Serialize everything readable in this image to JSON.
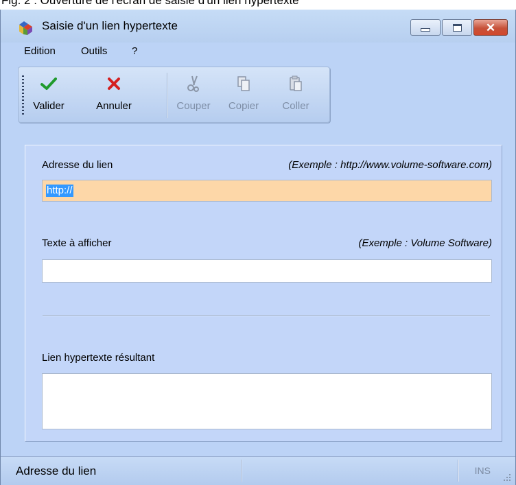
{
  "caption": "Fig. 2 : Ouverture de l'écran de saisie d'un lien hypertexte",
  "window": {
    "title": "Saisie d'un lien hypertexte",
    "app_icon": "books-icon",
    "controls": {
      "minimize": "minimize-icon",
      "maximize": "maximize-icon",
      "close": "close-icon"
    }
  },
  "menu": {
    "items": [
      {
        "label": "Edition"
      },
      {
        "label": "Outils"
      },
      {
        "label": "?"
      }
    ]
  },
  "toolbar": {
    "items": [
      {
        "label": "Valider",
        "icon": "checkmark-icon",
        "enabled": true
      },
      {
        "label": "Annuler",
        "icon": "cross-icon",
        "enabled": true
      },
      {
        "label": "Couper",
        "icon": "scissors-icon",
        "enabled": false
      },
      {
        "label": "Copier",
        "icon": "copy-icon",
        "enabled": false
      },
      {
        "label": "Coller",
        "icon": "paste-icon",
        "enabled": false
      }
    ]
  },
  "form": {
    "address": {
      "label": "Adresse du lien",
      "hint": "(Exemple : http://www.volume-software.com)",
      "value": "http://"
    },
    "display_text": {
      "label": "Texte à afficher",
      "hint": "(Exemple : Volume Software)",
      "value": ""
    },
    "result": {
      "label": "Lien hypertexte résultant",
      "value": ""
    }
  },
  "statusbar": {
    "text": "Adresse du lien",
    "mode": "INS"
  },
  "colors": {
    "active_field": "#fdd7a8",
    "window_bg": "#bcd3f6",
    "selection": "#3399ff"
  }
}
